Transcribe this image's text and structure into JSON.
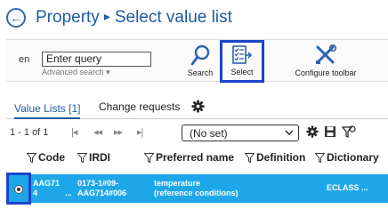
{
  "header": {
    "title": "Property",
    "separator": "▸",
    "subtitle": "Select value list"
  },
  "toolbar": {
    "language": "en",
    "query_value": "Enter query",
    "advanced_search": "Advanced search ▾",
    "search_label": "Search",
    "select_label": "Select",
    "configure_label": "Configure toolbar"
  },
  "tabs": [
    {
      "label": "Value Lists [1]",
      "active": true
    },
    {
      "label": "Change requests",
      "active": false
    }
  ],
  "pager": {
    "count": "1 - 1 of 1",
    "first": "|◂",
    "prev": "◂◂",
    "next": "▸▸",
    "last": "▸|",
    "dropdown_value": "(No set)"
  },
  "columns": [
    "Code",
    "IRDI",
    "Preferred name",
    "Definition",
    "Dictionary"
  ],
  "rows": [
    {
      "code_1": "AAG71",
      "code_2": "4",
      "irdi_1": "0173-1#09-",
      "irdi_2": "AAG714#006",
      "name_1": "temperature",
      "name_2": "(reference conditions)",
      "dictionary": "ECLASS ..."
    }
  ],
  "colors": {
    "title": "#1f5aa0",
    "highlight": "#1a44c8",
    "row_selected": "#1ea7e8"
  }
}
